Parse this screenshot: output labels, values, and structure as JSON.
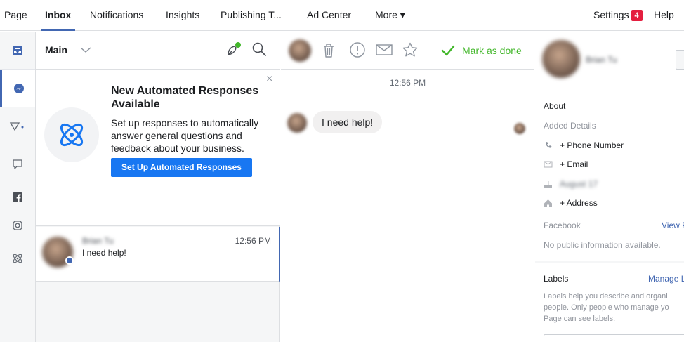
{
  "topnav": {
    "tabs": [
      {
        "label": "Page"
      },
      {
        "label": "Inbox"
      },
      {
        "label": "Notifications"
      },
      {
        "label": "Insights"
      },
      {
        "label": "Publishing T..."
      },
      {
        "label": "Ad Center"
      },
      {
        "label": "More ▾"
      }
    ],
    "settings_label": "Settings",
    "settings_badge": "4",
    "help_label": "Help"
  },
  "list_header": {
    "filter_label": "Main"
  },
  "promo": {
    "title": "New Automated Responses Available",
    "body": "Set up responses to automatically answer general questions and feedback about your business.",
    "button_label": "Set Up Automated Responses",
    "close_glyph": "×"
  },
  "conversation": {
    "name": "Brian Tu",
    "time": "12:56 PM",
    "snippet": "I need help!"
  },
  "thread": {
    "mark_done_label": "Mark as done",
    "timestamp": "12:56 PM",
    "message_text": "I need help!"
  },
  "info": {
    "name": "Brian Tu",
    "about_heading": "About",
    "added_details": "Added Details",
    "phone_label": "+ Phone Number",
    "email_label": "+ Email",
    "birthday_value": "August 17",
    "address_label": "+ Address",
    "facebook_label": "Facebook",
    "view_link": "View P",
    "no_public_info": "No public information available.",
    "labels_heading": "Labels",
    "manage_link": "Manage L",
    "labels_help_line1": "Labels help you describe and organi",
    "labels_help_line2": "people. Only people who manage yo",
    "labels_help_line3": "Page can see labels."
  },
  "colors": {
    "brand_blue": "#4267b2",
    "button_blue": "#1877f2",
    "done_green": "#42b72a",
    "badge_red": "#e41e3f"
  }
}
